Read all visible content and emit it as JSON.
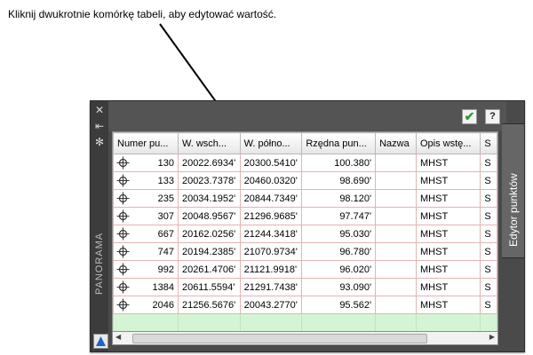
{
  "caption": "Kliknij dwukrotnie komórkę tabeli, aby edytować wartość.",
  "panel": {
    "vertical_label": "PANORAMA",
    "side_tab": "Edytor punktów",
    "toolbar": {
      "accept_icon": "✔",
      "help_label": "?"
    },
    "strip": {
      "close_icon": "✕",
      "pin_icon": "⇤",
      "settings_icon": "✻"
    }
  },
  "table": {
    "columns": [
      "Numer pu...",
      "W. wsch...",
      "W. półno...",
      "Rzędna pun...",
      "Nazwa",
      "Opis wstę...",
      "S"
    ],
    "rows": [
      {
        "num": "130",
        "east": "20022.6934'",
        "north": "20300.5410'",
        "elev": "100.380'",
        "name": "",
        "desc": "MHST",
        "s": "S"
      },
      {
        "num": "133",
        "east": "20023.7378'",
        "north": "20460.0320'",
        "elev": "98.690'",
        "name": "",
        "desc": "MHST",
        "s": "S"
      },
      {
        "num": "235",
        "east": "20034.1952'",
        "north": "20844.7349'",
        "elev": "98.120'",
        "name": "",
        "desc": "MHST",
        "s": "S"
      },
      {
        "num": "307",
        "east": "20048.9567'",
        "north": "21296.9685'",
        "elev": "97.747'",
        "name": "",
        "desc": "MHST",
        "s": "S"
      },
      {
        "num": "667",
        "east": "20162.0256'",
        "north": "21244.3418'",
        "elev": "95.030'",
        "name": "",
        "desc": "MHST",
        "s": "S"
      },
      {
        "num": "747",
        "east": "20194.2385'",
        "north": "21070.9734'",
        "elev": "96.780'",
        "name": "",
        "desc": "MHST",
        "s": "S"
      },
      {
        "num": "992",
        "east": "20261.4706'",
        "north": "21121.9918'",
        "elev": "96.020'",
        "name": "",
        "desc": "MHST",
        "s": "S"
      },
      {
        "num": "1384",
        "east": "20611.5594'",
        "north": "21291.7438'",
        "elev": "93.090'",
        "name": "",
        "desc": "MHST",
        "s": "S"
      },
      {
        "num": "2046",
        "east": "21256.5676'",
        "north": "20043.2770'",
        "elev": "95.562'",
        "name": "",
        "desc": "MHST",
        "s": "S"
      }
    ]
  },
  "colors": {
    "panel": "#4a4a4a",
    "new_row": "#d4f5d4",
    "accept": "#2e9b2e"
  }
}
